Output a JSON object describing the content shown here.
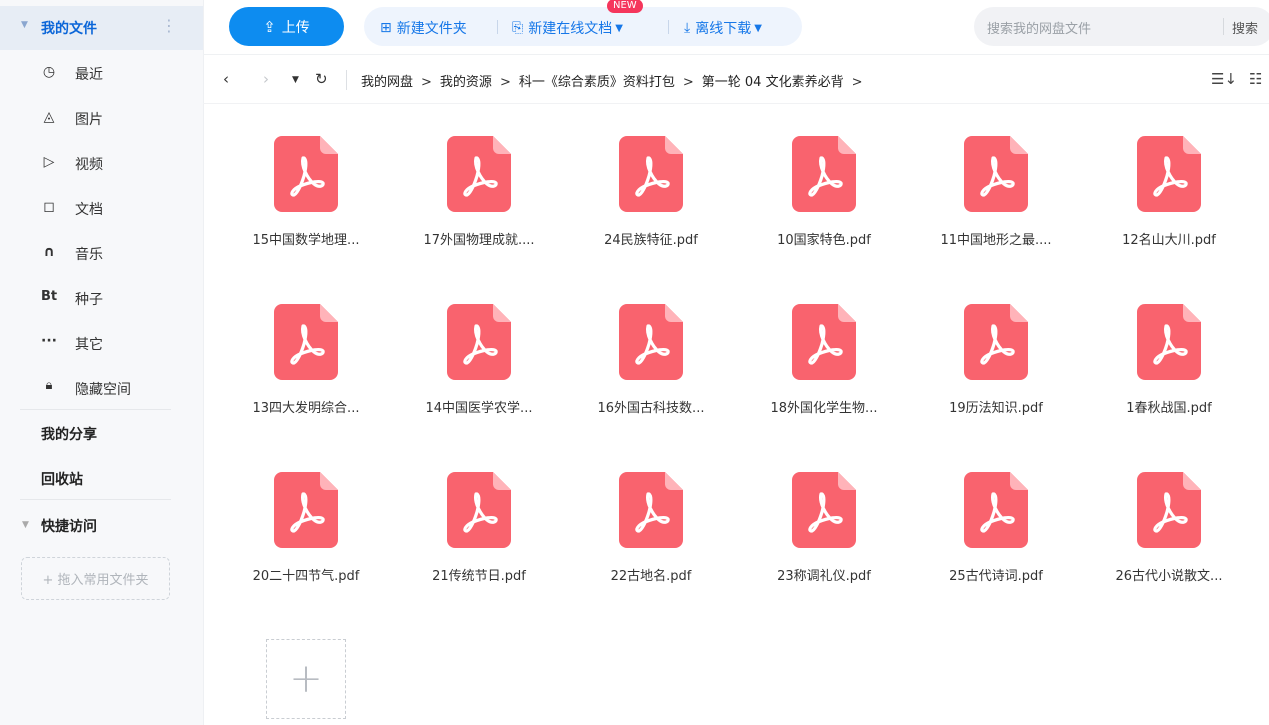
{
  "sidebar": {
    "my_files": "我的文件",
    "my_files_more": "⋮",
    "items": [
      {
        "icon": "clock-icon",
        "glyph": "◷",
        "label": "最近"
      },
      {
        "icon": "image-icon",
        "glyph": "◬",
        "label": "图片"
      },
      {
        "icon": "video-icon",
        "glyph": "▷",
        "label": "视频"
      },
      {
        "icon": "document-icon",
        "glyph": "◻",
        "label": "文档"
      },
      {
        "icon": "headphones-icon",
        "glyph": "∩",
        "label": "音乐"
      },
      {
        "icon": "torrent-icon",
        "glyph": "Bt",
        "label": "种子"
      },
      {
        "icon": "more-icon",
        "glyph": "···",
        "label": "其它"
      },
      {
        "icon": "lock-icon",
        "glyph": "🔒︎",
        "label": "隐藏空间"
      }
    ],
    "my_share": "我的分享",
    "recycle_bin": "回收站",
    "quick_access": "快捷访问",
    "drop_folder": "+ 拖入常用文件夹"
  },
  "toolbar": {
    "upload": "上传",
    "new_folder": "新建文件夹",
    "new_online_doc": "新建在线文档",
    "new_badge": "NEW",
    "offline_download": "离线下载",
    "search_placeholder": "搜索我的网盘文件",
    "search_button": "搜索"
  },
  "breadcrumb": [
    "我的网盘",
    "我的资源",
    "科一《综合素质》资料打包",
    "第一轮 04 文化素养必背"
  ],
  "breadcrumb_trailing": ">",
  "files": [
    "15中国数学地理...",
    "17外国物理成就....",
    "24民族特征.pdf",
    "10国家特色.pdf",
    "11中国地形之最....",
    "12名山大川.pdf",
    "13四大发明综合...",
    "14中国医学农学...",
    "16外国古科技数...",
    "18外国化学生物...",
    "19历法知识.pdf",
    "1春秋战国.pdf",
    "20二十四节气.pdf",
    "21传统节日.pdf",
    "22古地名.pdf",
    "23称调礼仪.pdf",
    "25古代诗词.pdf",
    "26古代小说散文..."
  ],
  "colors": {
    "accent": "#0d8cf0",
    "pdf_red": "#f9636e",
    "sidebar_active": "#0b66d8"
  }
}
